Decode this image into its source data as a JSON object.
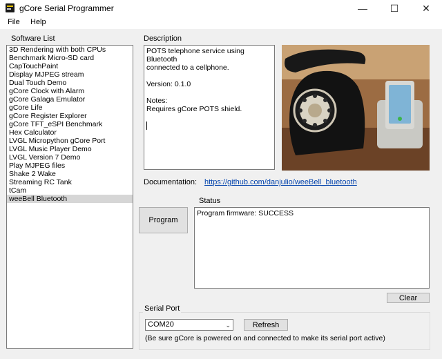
{
  "window": {
    "title": "gCore Serial Programmer",
    "minimize": "—",
    "maximize": "☐",
    "close": "✕"
  },
  "menu": [
    "File",
    "Help"
  ],
  "software_list": {
    "label": "Software List",
    "items": [
      "3D Rendering with both CPUs",
      "Benchmark Micro-SD card",
      "CapTouchPaint",
      "Display MJPEG stream",
      "Dual Touch Demo",
      "gCore Clock with Alarm",
      "gCore Galaga Emulator",
      "gCore Life",
      "gCore Register Explorer",
      "gCore TFT_eSPI Benchmark",
      "Hex Calculator",
      "LVGL Micropython gCore Port",
      "LVGL Music Player Demo",
      "LVGL Version 7 Demo",
      "Play MJPEG files",
      "Shake 2 Wake",
      "Streaming RC Tank",
      "tCam",
      "weeBell Bluetooth"
    ],
    "selected_index": 18
  },
  "description": {
    "label": "Description",
    "text": "POTS telephone service using Bluetooth\nconnected to a cellphone.\n\nVersion: 0.1.0\n\nNotes:\nRequires gCore POTS shield."
  },
  "documentation": {
    "label": "Documentation:",
    "link": "https://github.com/danjulio/weeBell_bluetooth"
  },
  "program_button": "Program",
  "status": {
    "label": "Status",
    "text": "Program firmware: SUCCESS"
  },
  "clear_button": "Clear",
  "serial_port": {
    "label": "Serial Port",
    "selected": "COM20",
    "refresh_button": "Refresh",
    "note": "(Be sure gCore is powered on and connected to make its serial port active)"
  },
  "colors": {
    "selection": "#d6d6d6",
    "link": "#0645ad",
    "panel_bg": "#f0f0f0",
    "button_bg": "#e1e1e1"
  }
}
